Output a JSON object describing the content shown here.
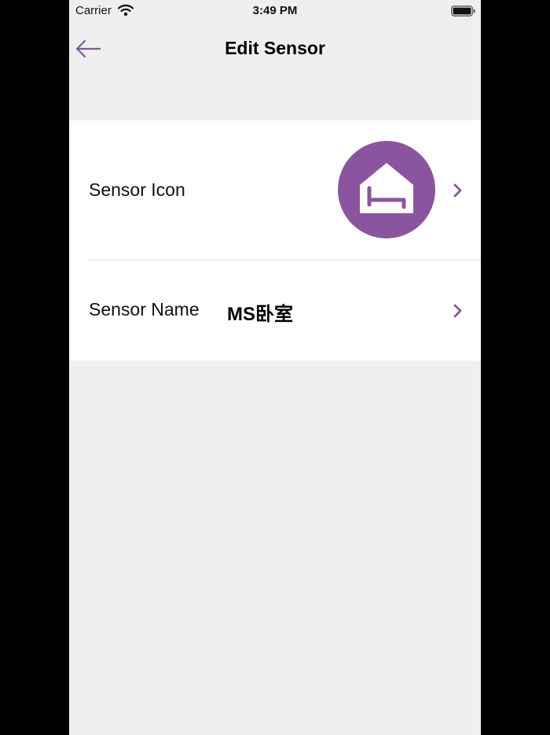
{
  "status_bar": {
    "carrier": "Carrier",
    "time": "3:49 PM"
  },
  "nav": {
    "title": "Edit Sensor",
    "back_icon": "arrow-left-icon"
  },
  "settings": {
    "icon_row": {
      "label": "Sensor Icon",
      "icon": "house-bed-icon"
    },
    "name_row": {
      "label": "Sensor Name",
      "value": "MS卧室"
    }
  },
  "colors": {
    "accent": "#8a559e",
    "background": "#efefef",
    "card": "#ffffff"
  }
}
